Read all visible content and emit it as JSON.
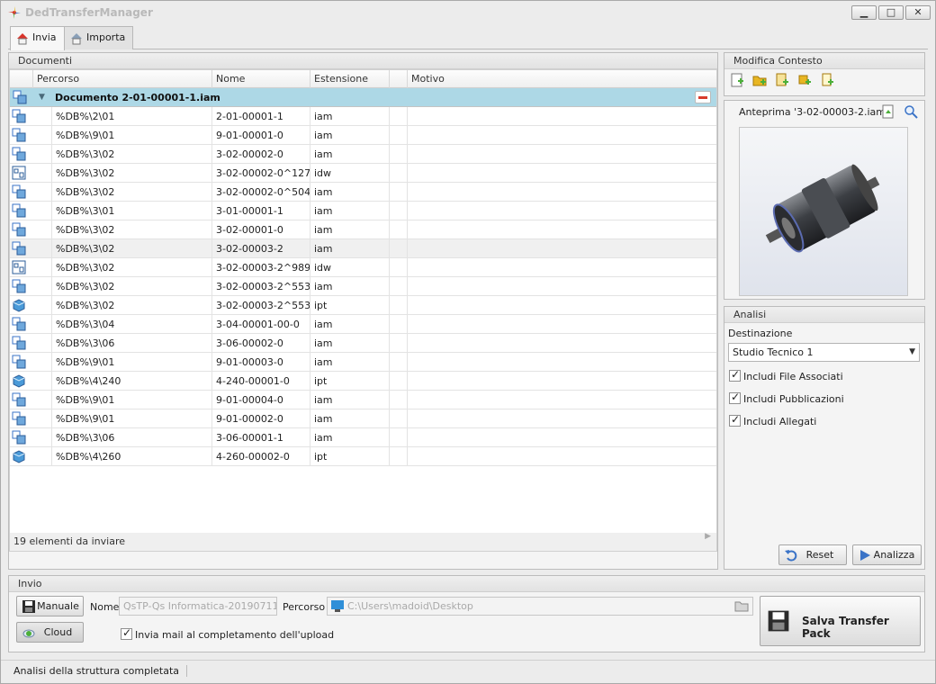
{
  "window": {
    "title": "DedTransferManager",
    "controls": {
      "minimize": "▁",
      "maximize": "□",
      "close": "✕"
    }
  },
  "tabs": [
    {
      "label": "Invia",
      "active": true
    },
    {
      "label": "Importa",
      "active": false
    }
  ],
  "documents": {
    "header": "Documenti",
    "columns": [
      "Percorso",
      "Nome",
      "Estensione",
      "Motivo"
    ],
    "group_label": "Documento 2-01-00001-1.iam",
    "rows": [
      {
        "path": "%DB%\\2\\01",
        "name": "2-01-00001-1",
        "ext": "iam",
        "icon": "assembly-icon"
      },
      {
        "path": "%DB%\\9\\01",
        "name": "9-01-00001-0",
        "ext": "iam",
        "icon": "assembly-icon"
      },
      {
        "path": "%DB%\\3\\02",
        "name": "3-02-00002-0",
        "ext": "iam",
        "icon": "assembly-icon"
      },
      {
        "path": "%DB%\\3\\02",
        "name": "3-02-00002-0^127...",
        "ext": "idw",
        "icon": "drawing-icon"
      },
      {
        "path": "%DB%\\3\\02",
        "name": "3-02-00002-0^504...",
        "ext": "iam",
        "icon": "assembly-icon"
      },
      {
        "path": "%DB%\\3\\01",
        "name": "3-01-00001-1",
        "ext": "iam",
        "icon": "assembly-icon"
      },
      {
        "path": "%DB%\\3\\02",
        "name": "3-02-00001-0",
        "ext": "iam",
        "icon": "assembly-icon"
      },
      {
        "path": "%DB%\\3\\02",
        "name": "3-02-00003-2",
        "ext": "iam",
        "icon": "assembly-icon",
        "selected": true
      },
      {
        "path": "%DB%\\3\\02",
        "name": "3-02-00003-2^989...",
        "ext": "idw",
        "icon": "drawing-icon"
      },
      {
        "path": "%DB%\\3\\02",
        "name": "3-02-00003-2^553...",
        "ext": "iam",
        "icon": "assembly-icon"
      },
      {
        "path": "%DB%\\3\\02",
        "name": "3-02-00003-2^553...",
        "ext": "ipt",
        "icon": "part-icon"
      },
      {
        "path": "%DB%\\3\\04",
        "name": "3-04-00001-00-0",
        "ext": "iam",
        "icon": "assembly-icon"
      },
      {
        "path": "%DB%\\3\\06",
        "name": "3-06-00002-0",
        "ext": "iam",
        "icon": "assembly-icon"
      },
      {
        "path": "%DB%\\9\\01",
        "name": "9-01-00003-0",
        "ext": "iam",
        "icon": "assembly-icon"
      },
      {
        "path": "%DB%\\4\\240",
        "name": "4-240-00001-0",
        "ext": "ipt",
        "icon": "part-icon"
      },
      {
        "path": "%DB%\\9\\01",
        "name": "9-01-00004-0",
        "ext": "iam",
        "icon": "assembly-icon"
      },
      {
        "path": "%DB%\\9\\01",
        "name": "9-01-00002-0",
        "ext": "iam",
        "icon": "assembly-icon"
      },
      {
        "path": "%DB%\\3\\06",
        "name": "3-06-00001-1",
        "ext": "iam",
        "icon": "assembly-icon"
      },
      {
        "path": "%DB%\\4\\260",
        "name": "4-260-00002-0",
        "ext": "ipt",
        "icon": "part-icon"
      }
    ],
    "footer": "19 elementi da inviare"
  },
  "context": {
    "header": "Modifica Contesto"
  },
  "preview": {
    "title": "Anteprima '3-02-00003-2.iam'"
  },
  "analysis": {
    "header": "Analisi",
    "destination_label": "Destinazione",
    "destination_value": "Studio Tecnico 1",
    "checks": [
      {
        "label": "Includi File Associati",
        "checked": true
      },
      {
        "label": "Includi Pubblicazioni",
        "checked": true
      },
      {
        "label": "Includi Allegati",
        "checked": true
      }
    ],
    "reset_label": "Reset",
    "analyze_label": "Analizza"
  },
  "send": {
    "header": "Invio",
    "manual_label": "Manuale",
    "cloud_label": "Cloud",
    "name_label": "Nome",
    "name_value": "QsTP-Qs Informatica-201907111...",
    "path_label": "Percorso",
    "path_value": "C:\\Users\\madoid\\Desktop",
    "mail_label": "Invia mail al completamento dell'upload",
    "mail_checked": true,
    "save_label": "Salva Transfer Pack"
  },
  "status": {
    "text": "Analisi della struttura completata"
  },
  "colors": {
    "group_row": "#add8e6",
    "accent_blue": "#3a73c7",
    "toolbar_green": "#4caf3a",
    "toolbar_yellow": "#e8b623",
    "minus_red": "#d83a2b"
  }
}
